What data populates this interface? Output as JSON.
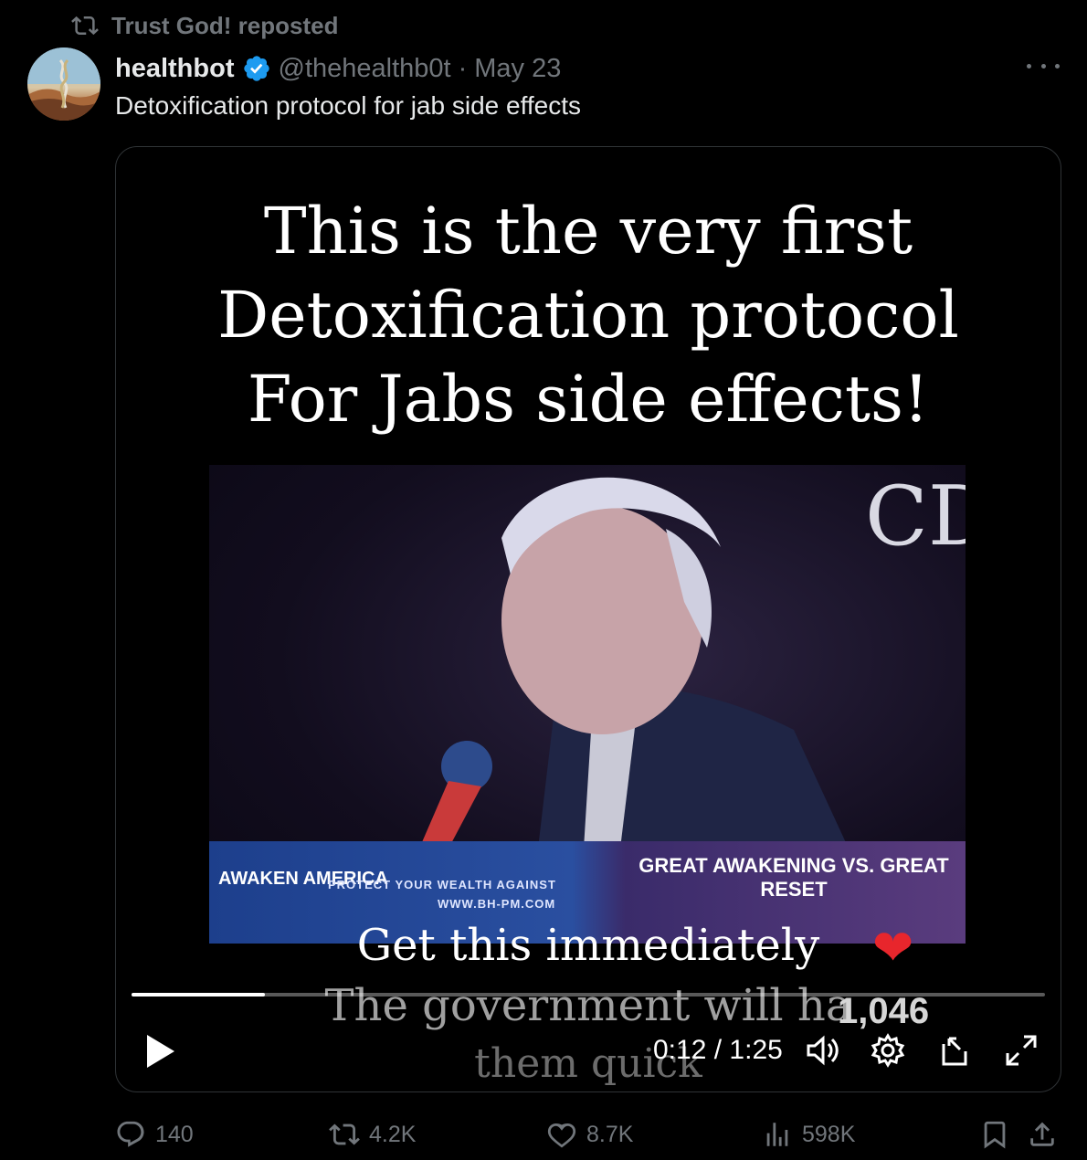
{
  "repost": {
    "label": "Trust God! reposted",
    "icon": "repost-icon"
  },
  "author": {
    "name": "healthbot",
    "handle": "@thehealthb0t",
    "separator": "·",
    "date": "May 23",
    "verified_icon": "verified-badge-icon",
    "verified_color": "#1d9bf0"
  },
  "tweet": {
    "text": "Detoxification protocol for jab side effects"
  },
  "media": {
    "headline_lines": [
      "This is the very first",
      "Detoxification protocol",
      "For Jabs side effects!"
    ],
    "subtitle_lines": [
      "Get this immediately",
      "The government will ha",
      "them quick"
    ],
    "overlay_count": "1,046",
    "banner_left": "AWAKEN AMERICA",
    "banner_mid": "PROTECT YOUR WEALTH AGAINST",
    "banner_mid2": "WWW.BH-PM.COM",
    "banner_right": "GREAT AWAKENING VS. GREAT RESET",
    "logo_text": "CD",
    "player": {
      "current_time": "0:12",
      "separator": "/",
      "duration": "1:25",
      "progress_fraction": 0.146,
      "icons": [
        "play-icon",
        "volume-icon",
        "settings-icon",
        "pip-icon",
        "fullscreen-icon"
      ]
    }
  },
  "actions": {
    "replies": "140",
    "reposts": "4.2K",
    "likes": "8.7K",
    "views": "598K",
    "icons": [
      "reply-icon",
      "repost-icon",
      "like-icon",
      "views-icon",
      "bookmark-icon",
      "share-icon"
    ]
  },
  "colors": {
    "background": "#000000",
    "muted": "#71767b",
    "text": "#e7e9ea",
    "border": "#2f3336",
    "heart": "#e8262c"
  }
}
